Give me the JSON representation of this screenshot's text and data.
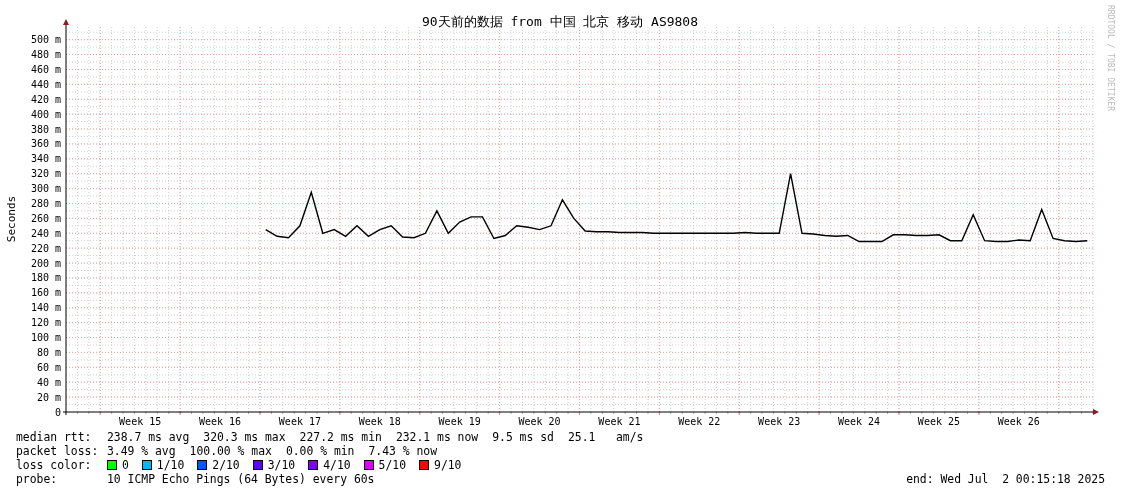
{
  "chart": {
    "chart_data": {
      "type": "line",
      "title": "90天前的数据 from 中国 北京 移动 AS9808",
      "ylabel": "Seconds",
      "ylim": [
        0,
        517
      ],
      "yticks": [
        {
          "value": 0,
          "label": "0"
        },
        {
          "value": 20,
          "label": "20 m"
        },
        {
          "value": 40,
          "label": "40 m"
        },
        {
          "value": 60,
          "label": "60 m"
        },
        {
          "value": 80,
          "label": "80 m"
        },
        {
          "value": 100,
          "label": "100 m"
        },
        {
          "value": 120,
          "label": "120 m"
        },
        {
          "value": 140,
          "label": "140 m"
        },
        {
          "value": 160,
          "label": "160 m"
        },
        {
          "value": 180,
          "label": "180 m"
        },
        {
          "value": 200,
          "label": "200 m"
        },
        {
          "value": 220,
          "label": "220 m"
        },
        {
          "value": 240,
          "label": "240 m"
        },
        {
          "value": 260,
          "label": "260 m"
        },
        {
          "value": 280,
          "label": "280 m"
        },
        {
          "value": 300,
          "label": "300 m"
        },
        {
          "value": 320,
          "label": "320 m"
        },
        {
          "value": 340,
          "label": "340 m"
        },
        {
          "value": 360,
          "label": "360 m"
        },
        {
          "value": 380,
          "label": "380 m"
        },
        {
          "value": 400,
          "label": "400 m"
        },
        {
          "value": 420,
          "label": "420 m"
        },
        {
          "value": 440,
          "label": "440 m"
        },
        {
          "value": 460,
          "label": "460 m"
        },
        {
          "value": 480,
          "label": "480 m"
        },
        {
          "value": 500,
          "label": "500 m"
        }
      ],
      "categories": [
        null,
        null,
        null,
        null,
        null,
        null,
        "Week 15",
        null,
        null,
        null,
        null,
        null,
        null,
        "Week 16",
        null,
        null,
        null,
        null,
        null,
        null,
        "Week 17",
        null,
        null,
        null,
        null,
        null,
        null,
        "Week 18",
        null,
        null,
        null,
        null,
        null,
        null,
        "Week 19",
        null,
        null,
        null,
        null,
        null,
        null,
        "Week 20",
        null,
        null,
        null,
        null,
        null,
        null,
        "Week 21",
        null,
        null,
        null,
        null,
        null,
        null,
        "Week 22",
        null,
        null,
        null,
        null,
        null,
        null,
        "Week 23",
        null,
        null,
        null,
        null,
        null,
        null,
        "Week 24",
        null,
        null,
        null,
        null,
        null,
        null,
        "Week 25",
        null,
        null,
        null,
        null,
        null,
        null,
        "Week 26",
        null,
        null,
        null,
        null,
        null,
        null
      ],
      "series": [
        {
          "color": "#000000",
          "values": [
            null,
            null,
            null,
            null,
            null,
            null,
            null,
            null,
            null,
            null,
            null,
            null,
            null,
            null,
            null,
            null,
            null,
            245,
            236,
            234,
            250,
            295,
            240,
            245,
            236,
            250,
            236,
            245,
            250,
            235,
            234,
            240,
            270,
            240,
            255,
            262,
            262,
            233,
            237,
            250,
            248,
            245,
            250,
            285,
            260,
            243,
            242,
            242,
            241,
            241,
            241,
            240,
            240,
            240,
            240,
            240,
            240,
            240,
            240,
            241,
            240,
            240,
            240,
            320,
            240,
            239,
            237,
            236,
            237,
            229,
            229,
            229,
            238,
            238,
            237,
            237,
            238,
            230,
            230,
            265,
            230,
            229,
            229,
            231,
            230,
            272,
            233,
            230,
            229,
            230
          ]
        }
      ],
      "grid": true
    },
    "credit": "RRDTOOL / TOBI OETIKER"
  },
  "legend": {
    "median": {
      "label": "median rtt:",
      "values": [
        "238.7 ms avg",
        "320.3 ms max",
        "227.2 ms min",
        "232.1 ms now",
        "9.5 ms sd",
        "25.1   am/s"
      ]
    },
    "loss": {
      "label": "packet loss:",
      "values": [
        "3.49 % avg",
        "100.00 % max",
        "0.00 % min",
        "7.43 % now"
      ]
    },
    "loss_color": {
      "label": "loss color:",
      "items": [
        {
          "label": "0",
          "color": "#00ff00"
        },
        {
          "label": "1/10",
          "color": "#00b8ff"
        },
        {
          "label": "2/10",
          "color": "#0059ff"
        },
        {
          "label": "3/10",
          "color": "#5e00ff"
        },
        {
          "label": "4/10",
          "color": "#7e00ff"
        },
        {
          "label": "5/10",
          "color": "#dd00ff"
        },
        {
          "label": "9/10",
          "color": "#ff0000"
        }
      ]
    },
    "probe": {
      "label": "probe:",
      "text": "10 ICMP Echo Pings (64 Bytes) every 60s",
      "end": "end: Wed Jul  2 00:15:18 2025"
    }
  }
}
